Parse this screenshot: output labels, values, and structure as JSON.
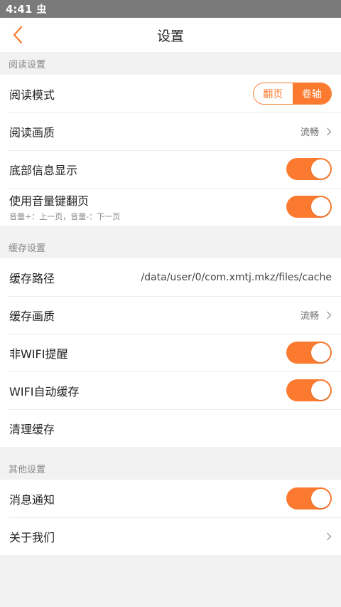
{
  "status_bar": {
    "time": "4:41",
    "notification_glyph": "虫"
  },
  "header": {
    "title": "设置"
  },
  "colors": {
    "accent": "#fb7a2f",
    "background": "#f2f2f2"
  },
  "reading": {
    "section_title": "阅读设置",
    "mode": {
      "label": "阅读模式",
      "options": [
        "翻页",
        "卷轴"
      ],
      "selected": "卷轴"
    },
    "quality": {
      "label": "阅读画质",
      "value": "流畅"
    },
    "bottom_info": {
      "label": "底部信息显示",
      "on": true
    },
    "volume_keys": {
      "label": "使用音量键翻页",
      "sub": "音量+：上一页，音量-：下一页",
      "on": true
    }
  },
  "cache": {
    "section_title": "缓存设置",
    "path": {
      "label": "缓存路径",
      "value": "/data/user/0/com.xmtj.mkz/files/cache"
    },
    "quality": {
      "label": "缓存画质",
      "value": "流畅"
    },
    "non_wifi": {
      "label": "非WIFI提醒",
      "on": true
    },
    "wifi_auto": {
      "label": "WIFI自动缓存",
      "on": true
    },
    "clear": {
      "label": "清理缓存"
    }
  },
  "other": {
    "section_title": "其他设置",
    "notification": {
      "label": "消息通知",
      "on": true
    },
    "about": {
      "label": "关于我们"
    }
  }
}
